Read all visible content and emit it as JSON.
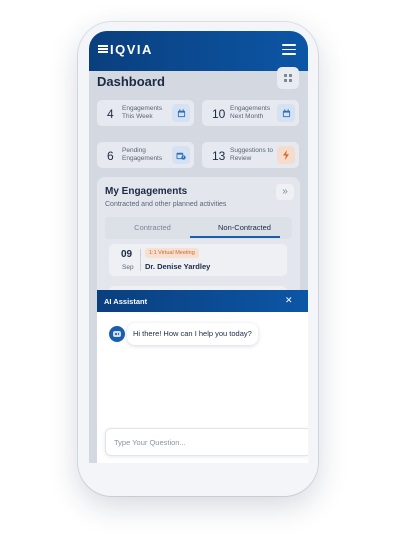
{
  "brand": {
    "logo_text": "IQVIA"
  },
  "header": {
    "menu_icon": "hamburger-icon"
  },
  "dashboard": {
    "title": "Dashboard",
    "grid_icon": "grid-icon",
    "stats": [
      {
        "value": "4",
        "label": "Engagements This Week",
        "icon": "calendar-icon",
        "color": "#2c6fbe"
      },
      {
        "value": "10",
        "label": "Engagements Next Month",
        "icon": "calendar-icon",
        "color": "#2c6fbe"
      },
      {
        "value": "6",
        "label": "Pending Engagements",
        "icon": "pending-calendar-icon",
        "color": "#2c6fbe"
      },
      {
        "value": "13",
        "label": "Suggestions to Review",
        "icon": "lightning-icon",
        "color": "#e0682a"
      }
    ]
  },
  "engagements": {
    "title": "My Engagements",
    "subtitle": "Contracted and other planned activities",
    "tabs": [
      {
        "label": "Contracted"
      },
      {
        "label": "Non-Contracted",
        "active": true
      }
    ],
    "items": [
      {
        "day": "09",
        "month": "Sep",
        "type": "1:1 Virtual Meeting",
        "name": "Dr. Denise Yardley"
      }
    ]
  },
  "ai_assistant": {
    "title": "AI Assistant",
    "greeting": "Hi there! How can I help you today?",
    "input_placeholder": "Type Your Question..."
  },
  "colors": {
    "brand_blue": "#0c56a6",
    "accent_orange": "#e0682a",
    "ink": "#1d2a44"
  }
}
